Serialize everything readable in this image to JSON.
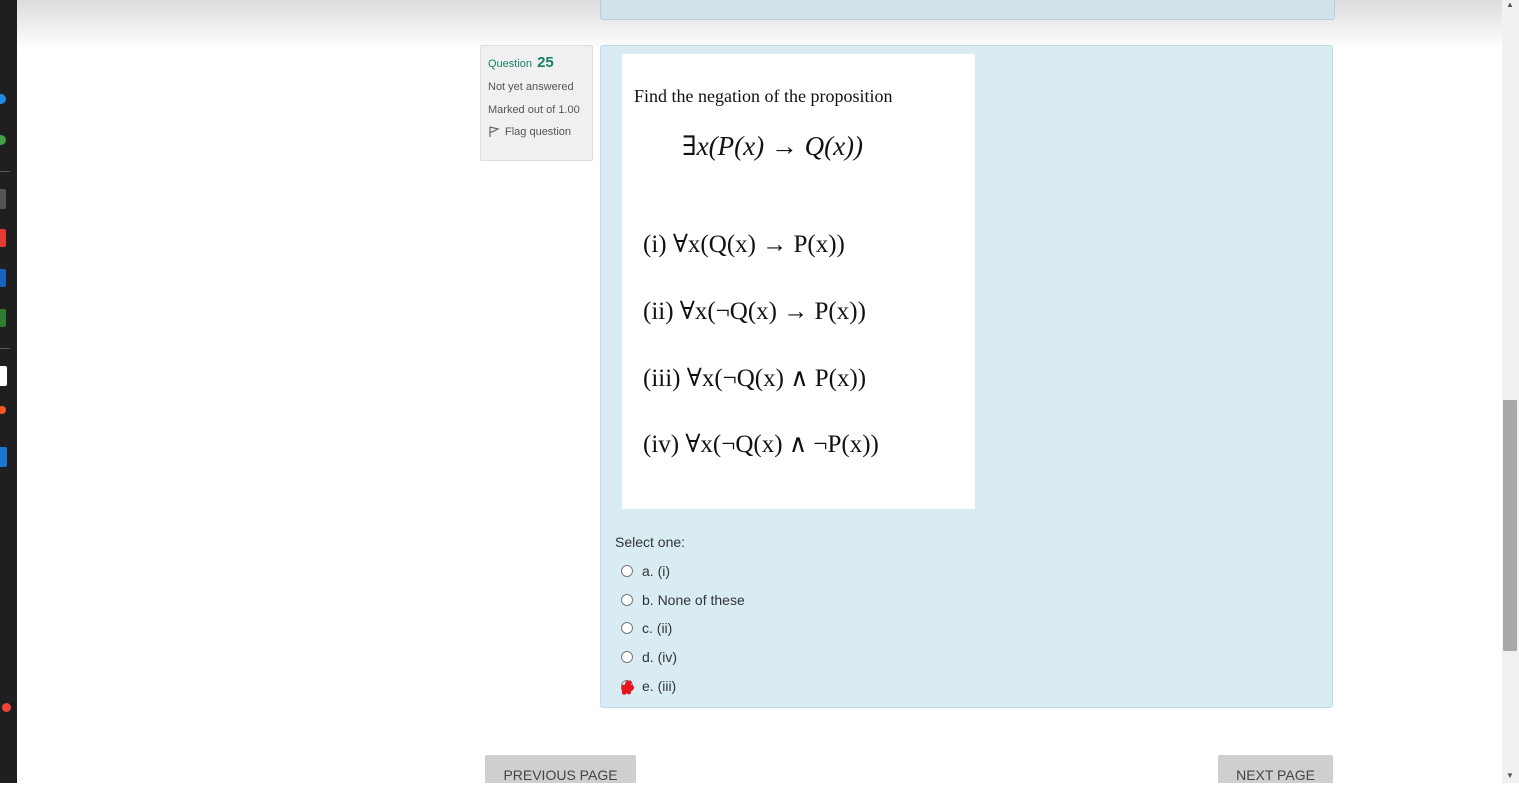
{
  "question": {
    "label": "Question",
    "number": "25",
    "state": "Not yet answered",
    "marks": "Marked out of 1.00",
    "flag_label": "Flag question"
  },
  "question_image": {
    "prompt": "Find the negation of the proposition",
    "formula": "∃x(P(x) → Q(x))",
    "options": [
      "(i) ∀x(Q(x) → P(x))",
      "(ii) ∀x(¬Q(x) → P(x))",
      "(iii) ∀x(¬Q(x) ∧ P(x))",
      "(iv) ∀x(¬Q(x) ∧ ¬P(x))"
    ]
  },
  "answer_block": {
    "prompt": "Select one:",
    "choices": [
      "a. (i)",
      "b. None of these",
      "c. (ii)",
      "d. (iv)",
      "e. (iii)"
    ]
  },
  "nav": {
    "prev_label": "PREVIOUS PAGE",
    "next_label": "NEXT PAGE"
  },
  "colors": {
    "accent": "#19806b",
    "content_bg": "#d9ecf4",
    "scribble": "#e8141e"
  }
}
